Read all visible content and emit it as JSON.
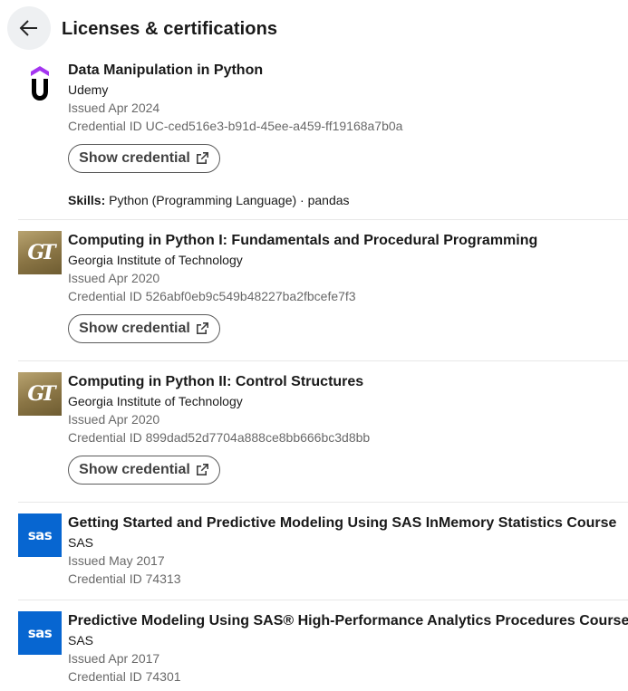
{
  "header": {
    "title": "Licenses & certifications",
    "back_icon": "arrow-left-icon"
  },
  "certifications": [
    {
      "title": "Data Manipulation in Python",
      "issuer": "Udemy",
      "issued": "Issued Apr 2024",
      "credential_id": "Credential ID UC-ced516e3-b91d-45ee-a459-ff19168a7b0a",
      "button_label": "Show credential",
      "skills_label": "Skills:",
      "skills": "Python (Programming Language) · pandas",
      "logo": "udemy-logo"
    },
    {
      "title": "Computing in Python I: Fundamentals and Procedural Programming",
      "issuer": "Georgia Institute of Technology",
      "issued": "Issued Apr 2020",
      "credential_id": "Credential ID 526abf0eb9c549b48227ba2fbcefe7f3",
      "button_label": "Show credential",
      "logo": "georgia-tech-logo",
      "logo_text": "GT"
    },
    {
      "title": "Computing in Python II: Control Structures",
      "issuer": "Georgia Institute of Technology",
      "issued": "Issued Apr 2020",
      "credential_id": "Credential ID 899dad52d7704a888ce8bb666bc3d8bb",
      "button_label": "Show credential",
      "logo": "georgia-tech-logo",
      "logo_text": "GT"
    },
    {
      "title": "Getting Started and Predictive Modeling Using SAS InMemory Statistics Course",
      "issuer": "SAS",
      "issued": "Issued May 2017",
      "credential_id": "Credential ID 74313",
      "logo": "sas-logo",
      "logo_text": "sas"
    },
    {
      "title": "Predictive Modeling Using SAS® High-Performance Analytics Procedures Course",
      "issuer": "SAS",
      "issued": "Issued Apr 2017",
      "credential_id": "Credential ID 74301",
      "logo": "sas-logo",
      "logo_text": "sas"
    }
  ],
  "colors": {
    "gt_gold": "#8a7545",
    "sas_blue": "#0766d1",
    "udemy_purple": "#a435f0"
  }
}
